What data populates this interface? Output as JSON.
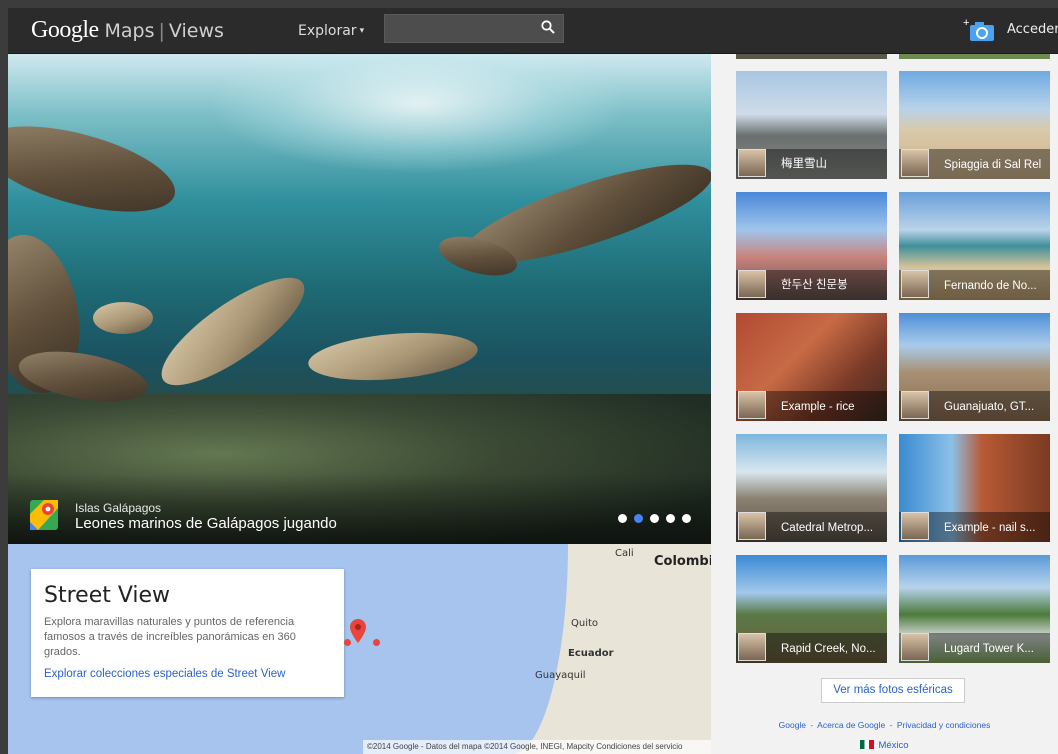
{
  "header": {
    "logo_brand": "Google",
    "logo_maps": "Maps",
    "logo_sep": "|",
    "logo_views": "Views",
    "explore_label": "Explorar",
    "explore_caret": "▾",
    "search_value": "",
    "search_placeholder": "",
    "signin_label": "Acceder"
  },
  "hero": {
    "subtitle": "Islas Galápagos",
    "title": "Leones marinos de Galápagos jugando",
    "slides_total": 5,
    "active_slide": 2
  },
  "map": {
    "labels": {
      "cali": "Cali",
      "colombia": "Colombi",
      "quito": "Quito",
      "ecuador": "Ecuador",
      "guayaquil": "Guayaquil"
    },
    "card": {
      "title": "Street View",
      "description": "Explora maravillas naturales y puntos de referencia famosos a través de increíbles panorámicas en 360 grados.",
      "link": "Explorar colecciones especiales de Street View"
    },
    "footer": "©2014 Google - Datos del mapa ©2014 Google, INEGI, Mapcity    Condiciones del servicio"
  },
  "gallery": {
    "tiles": [
      {
        "label": "梅里雪山"
      },
      {
        "label": "Spiaggia di Sal Rel"
      },
      {
        "label": "한두산 친문봉"
      },
      {
        "label": "Fernando de No..."
      },
      {
        "label": "Example - rice"
      },
      {
        "label": "Guanajuato, GT..."
      },
      {
        "label": "Catedral Metrop..."
      },
      {
        "label": "Example - nail s..."
      },
      {
        "label": "Rapid Creek, No..."
      },
      {
        "label": "Lugard Tower K..."
      }
    ],
    "more_button": "Ver más fotos esféricas"
  },
  "footer": {
    "link_google": "Google",
    "link_about": "Acerca de Google",
    "link_privacy": "Privacidad y condiciones",
    "sep": "-",
    "country": "México"
  },
  "colors": {
    "header_bg": "#2b2b2b",
    "accent_blue": "#4285f4",
    "link_blue": "#2a62c9",
    "pin_red": "#e8453c",
    "map_water": "#a6c4ee"
  }
}
